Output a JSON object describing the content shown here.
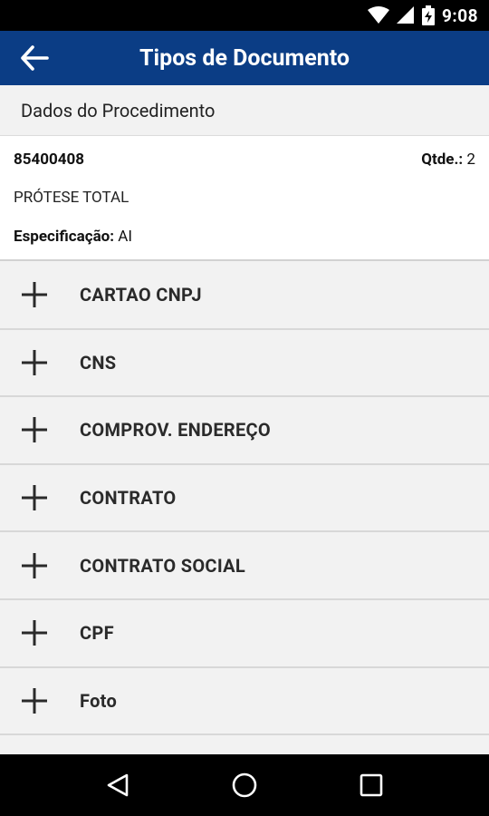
{
  "status_bar": {
    "time": "9:08",
    "icons": [
      "wifi-icon",
      "cell-signal-icon",
      "battery-charging-icon"
    ]
  },
  "app_bar": {
    "title": "Tipos de Documento",
    "back_icon": "arrow-left-icon",
    "color": "#0b3d85"
  },
  "section": {
    "title": "Dados do Procedimento"
  },
  "procedure": {
    "code": "85400408",
    "qty_label": "Qtde.:",
    "qty_value": " 2",
    "name": "PRÓTESE TOTAL",
    "spec_label": "Especificação:",
    "spec_value": " AI"
  },
  "documents": [
    {
      "label": "CARTAO CNPJ",
      "icon": "plus-icon"
    },
    {
      "label": "CNS",
      "icon": "plus-icon"
    },
    {
      "label": "COMPROV. ENDEREÇO",
      "icon": "plus-icon"
    },
    {
      "label": "CONTRATO",
      "icon": "plus-icon"
    },
    {
      "label": "CONTRATO SOCIAL",
      "icon": "plus-icon"
    },
    {
      "label": "CPF",
      "icon": "plus-icon"
    },
    {
      "label": "Foto",
      "icon": "plus-icon"
    }
  ],
  "nav_bar": {
    "buttons": [
      "back-triangle-icon",
      "home-circle-icon",
      "recents-square-icon"
    ]
  }
}
